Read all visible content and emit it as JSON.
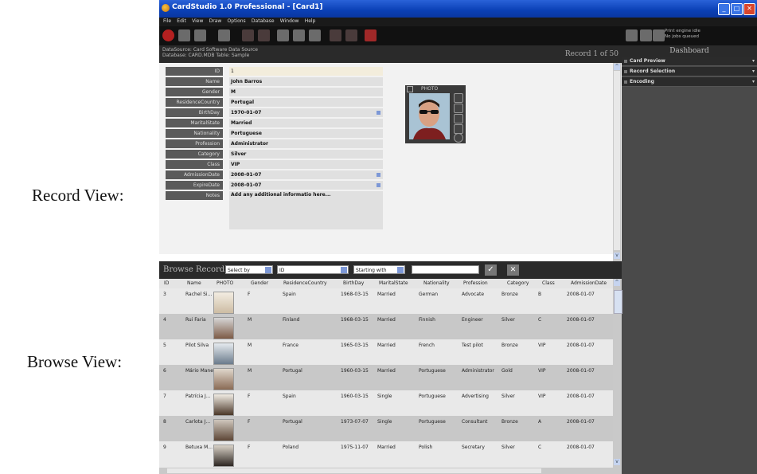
{
  "labels": {
    "record_view": "Record View:",
    "browse_view": "Browse View:"
  },
  "window": {
    "title": "CardStudio 1.0 Professional - [Card1]",
    "controls": {
      "minimize": "_",
      "maximize": "□",
      "close": "✕"
    }
  },
  "menu": [
    "File",
    "Edit",
    "View",
    "Draw",
    "Options",
    "Database",
    "Window",
    "Help"
  ],
  "printer": {
    "status": "Print engine idle",
    "jobs": "No jobs queued"
  },
  "record": {
    "datasource": "DataSource: Card Software Data Source",
    "database_table": "Database: CARD.MDB    Table: Sample",
    "counter": "Record 1 of 50",
    "photo_label": "PHOTO",
    "fields": [
      {
        "label": "ID",
        "value": "1"
      },
      {
        "label": "Name",
        "value": "John Barros"
      },
      {
        "label": "Gender",
        "value": "M"
      },
      {
        "label": "ResidenceCountry",
        "value": "Portugal"
      },
      {
        "label": "BirthDay",
        "value": "1970-01-07"
      },
      {
        "label": "MaritalState",
        "value": "Married"
      },
      {
        "label": "Nationality",
        "value": "Portuguese"
      },
      {
        "label": "Profession",
        "value": "Administrator"
      },
      {
        "label": "Category",
        "value": "Silver"
      },
      {
        "label": "Class",
        "value": "VIP"
      },
      {
        "label": "AdmissionDate",
        "value": "2008-01-07"
      },
      {
        "label": "ExpireDate",
        "value": "2008-01-07"
      },
      {
        "label": "Notes",
        "value": "Add any additional informatio here..."
      }
    ]
  },
  "dashboard": {
    "title": "Dashboard",
    "items": [
      "Card Preview",
      "Record Selection",
      "Encoding"
    ]
  },
  "browse": {
    "title": "Browse Records",
    "select_by": "Select by",
    "field": "ID",
    "mode": "Starting with",
    "search_value": "",
    "go": "✓",
    "clear": "✕",
    "columns": [
      "ID",
      "Name",
      "PHOTO",
      "Gender",
      "ResidenceCountry",
      "BirthDay",
      "MaritalState",
      "Nationality",
      "Profession",
      "Category",
      "Class",
      "AdmissionDate"
    ],
    "rows": [
      {
        "id": "3",
        "name": "Rachel Si...",
        "gender": "F",
        "country": "Spain",
        "birthday": "1968-03-15",
        "marital": "Married",
        "nationality": "German",
        "profession": "Advocate",
        "category": "Bronze",
        "class": "B",
        "admission": "2008-01-07"
      },
      {
        "id": "4",
        "name": "Rui Faria",
        "gender": "M",
        "country": "Finland",
        "birthday": "1968-03-15",
        "marital": "Married",
        "nationality": "Finnish",
        "profession": "Engineer",
        "category": "Silver",
        "class": "C",
        "admission": "2008-01-07"
      },
      {
        "id": "5",
        "name": "Pilot Silva",
        "gender": "M",
        "country": "France",
        "birthday": "1965-03-15",
        "marital": "Married",
        "nationality": "French",
        "profession": "Test pilot",
        "category": "Bronze",
        "class": "VIP",
        "admission": "2008-01-07"
      },
      {
        "id": "6",
        "name": "Mário Manel",
        "gender": "M",
        "country": "Portugal",
        "birthday": "1960-03-15",
        "marital": "Married",
        "nationality": "Portuguese",
        "profession": "Administrator",
        "category": "Gold",
        "class": "VIP",
        "admission": "2008-01-07"
      },
      {
        "id": "7",
        "name": "Patrícia J...",
        "gender": "F",
        "country": "Spain",
        "birthday": "1960-03-15",
        "marital": "Single",
        "nationality": "Portuguese",
        "profession": "Advertising",
        "category": "Silver",
        "class": "VIP",
        "admission": "2008-01-07"
      },
      {
        "id": "8",
        "name": "Carlota J...",
        "gender": "F",
        "country": "Portugal",
        "birthday": "1973-07-07",
        "marital": "Single",
        "nationality": "Portuguese",
        "profession": "Consultant",
        "category": "Bronze",
        "class": "A",
        "admission": "2008-01-07"
      },
      {
        "id": "9",
        "name": "Betuxa M...",
        "gender": "F",
        "country": "Poland",
        "birthday": "1975-11-07",
        "marital": "Married",
        "nationality": "Polish",
        "profession": "Secretary",
        "category": "Silver",
        "class": "C",
        "admission": "2008-01-07"
      }
    ]
  }
}
